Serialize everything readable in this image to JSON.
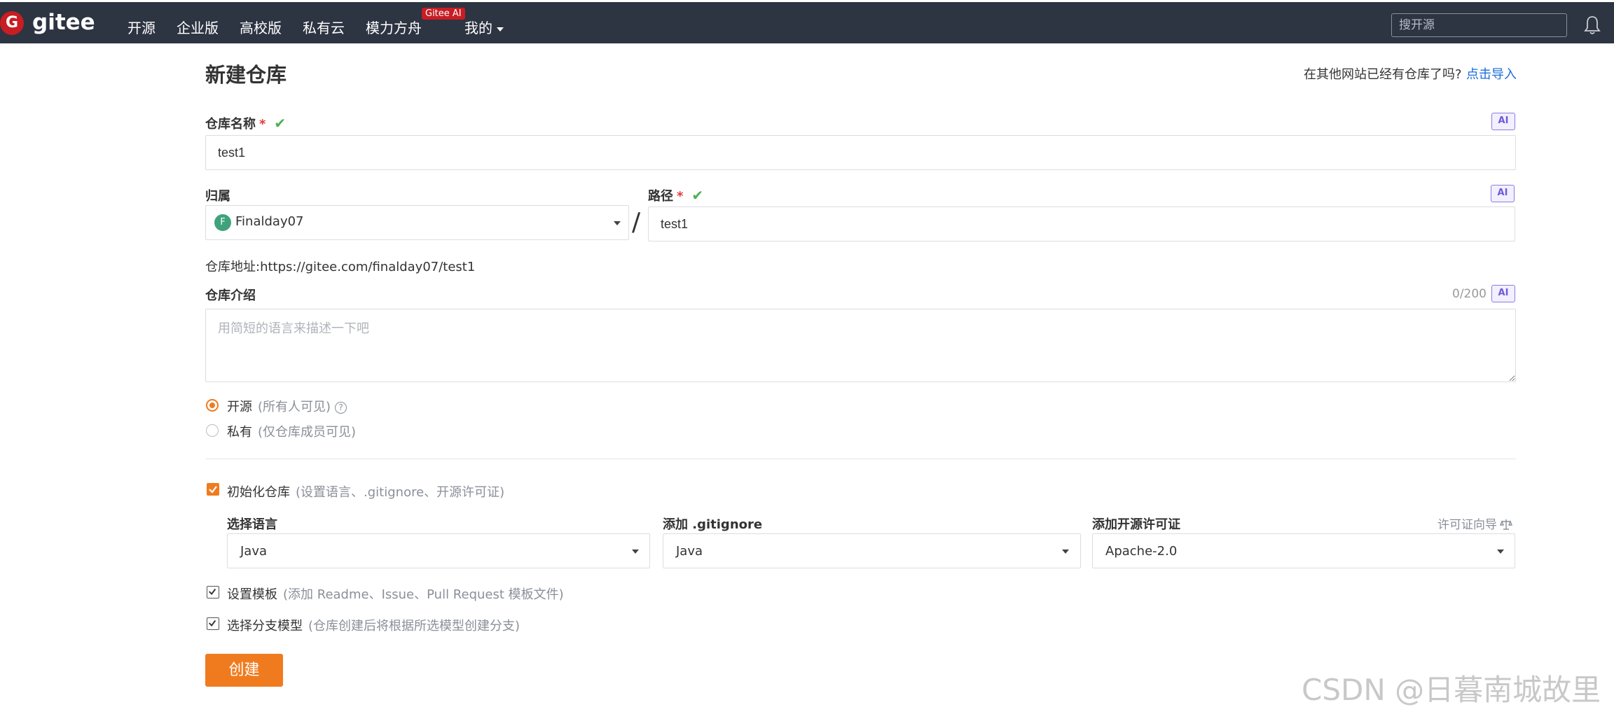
{
  "topbar": {
    "logo_letter": "G",
    "logo_text": "gitee",
    "nav": [
      "开源",
      "企业版",
      "高校版",
      "私有云",
      "模力方舟",
      "我的"
    ],
    "badge": "Gitee AI",
    "search_placeholder": "搜开源",
    "icons": [
      "gitee-logo-icon",
      "caret-down-icon",
      "bell-icon"
    ]
  },
  "page": {
    "title": "新建仓库",
    "import_text": "在其他网站已经有仓库了吗?",
    "import_link": "点击导入"
  },
  "form": {
    "name_label": "仓库名称",
    "required_mark": "*",
    "check_mark": "✔",
    "ai_label": "AI",
    "name_value": "test1",
    "owner_label": "归属",
    "owner_avatar": "F",
    "owner_value": "Finalday07",
    "slash": "/",
    "path_label": "路径",
    "path_value": "test1",
    "repo_address": "仓库地址:https://gitee.com/finalday07/test1",
    "desc_label": "仓库介绍",
    "desc_counter": "0/200",
    "desc_placeholder": "用简短的语言来描述一下吧",
    "visibility": [
      {
        "label": "开源",
        "hint": "(所有人可见)",
        "selected": true
      },
      {
        "label": "私有",
        "hint": "(仅仓库成员可见)",
        "selected": false
      }
    ],
    "help_icon": "?",
    "init": {
      "label": "初始化仓库",
      "hint": "(设置语言、.gitignore、开源许可证)",
      "checked": true
    },
    "language": {
      "label": "选择语言",
      "value": "Java"
    },
    "gitignore": {
      "label": "添加 .gitignore",
      "value": "Java"
    },
    "license": {
      "label": "添加开源许可证",
      "value": "Apache-2.0",
      "guide": "许可证向导"
    },
    "template": {
      "label": "设置模板",
      "hint": "(添加 Readme、Issue、Pull Request 模板文件)",
      "checked": true
    },
    "branch": {
      "label": "选择分支模型",
      "hint": "(仓库创建后将根据所选模型创建分支)",
      "checked": true
    },
    "submit": "创建"
  },
  "watermark": "CSDN @日暮南城故里",
  "colors": {
    "topbar": "#2d3442",
    "accent": "#f07b1f",
    "brand": "#c71d23",
    "link": "#1a6dd8",
    "ai": "#6b5cd6"
  }
}
